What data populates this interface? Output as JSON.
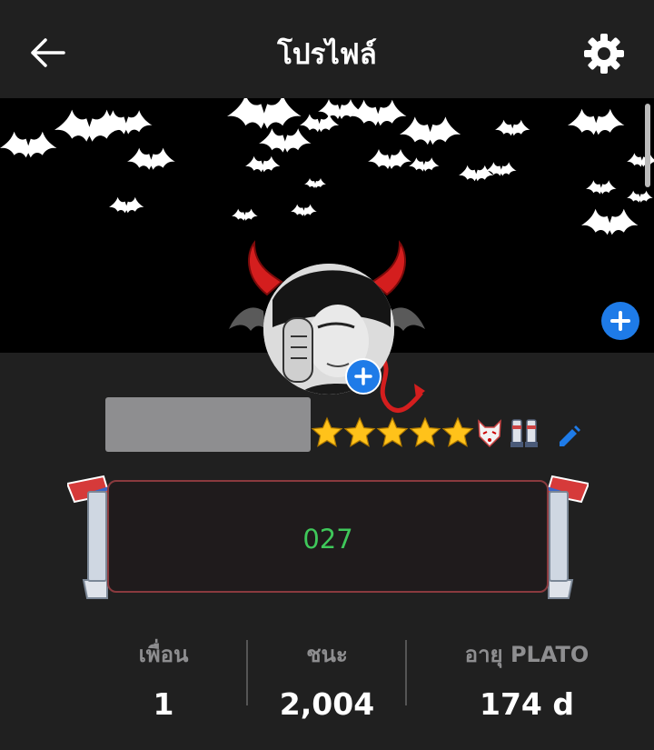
{
  "header": {
    "title": "โปรไฟล์"
  },
  "frame": {
    "number": "027"
  },
  "stats": [
    {
      "label": "เพื่อน",
      "value": "1"
    },
    {
      "label": "ชนะ",
      "value": "2,004"
    },
    {
      "label": "อายุ PLATO",
      "value": "174 d"
    }
  ],
  "rating": {
    "stars": 5,
    "max": 5
  },
  "colors": {
    "background": "#202020",
    "accent_blue": "#1e7be8",
    "star": "#ffc21a",
    "number_green": "#3fc85a",
    "label_gray": "#8e8e90"
  },
  "icons": {
    "back": "arrow-left-icon",
    "settings": "gear-icon",
    "add": "plus-icon",
    "edit": "pencil-icon"
  }
}
